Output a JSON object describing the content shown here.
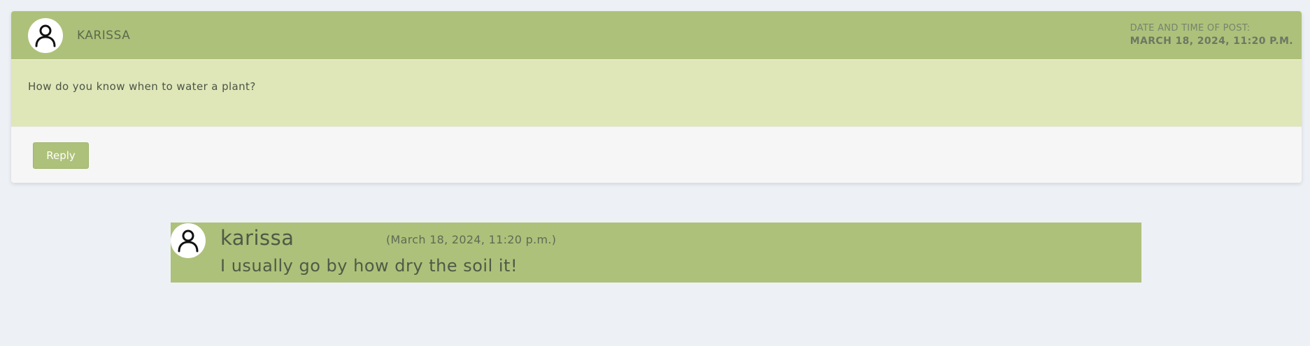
{
  "post": {
    "username": "KARISSA",
    "date_label": "DATE AND TIME OF POST:",
    "date_value": "MARCH 18, 2024, 11:20 P.M.",
    "content": "How do you know when to water a plant?",
    "reply_button_label": "Reply",
    "avatar_icon": "user-icon"
  },
  "reply": {
    "author": "karissa",
    "date": "(March 18, 2024, 11:20 p.m.)",
    "text": "I usually go by how dry the soil it!",
    "avatar_icon": "user-icon"
  },
  "colors": {
    "page_background": "#edf1f5",
    "header_green": "#aec17a",
    "body_green": "#dfe6b8",
    "footer_gray": "#f6f6f6"
  }
}
